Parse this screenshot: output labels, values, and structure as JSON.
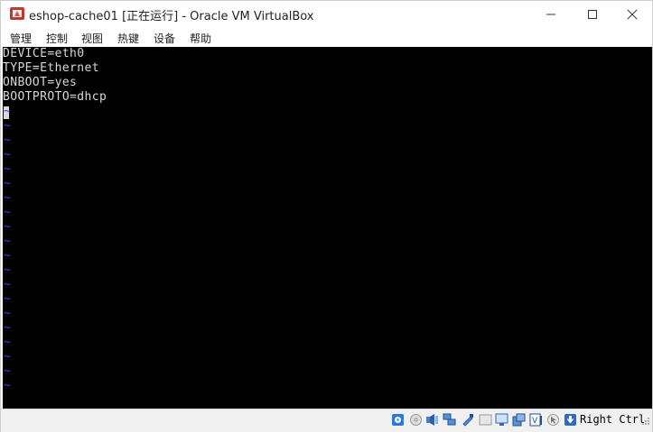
{
  "window": {
    "title": "eshop-cache01 [正在运行] - Oracle VM VirtualBox",
    "app_icon": "virtualbox-icon"
  },
  "menu": {
    "items": [
      "管理",
      "控制",
      "视图",
      "热键",
      "设备",
      "帮助"
    ]
  },
  "console": {
    "lines": [
      "DEVICE=eth0",
      "TYPE=Ethernet",
      "ONBOOT=yes",
      "BOOTPROTO=dhcp"
    ],
    "empty_marker": "~",
    "empty_line_count": 20,
    "colors": {
      "background": "#000000",
      "text": "#d8d8d8",
      "tilde": "#2f4fd8"
    }
  },
  "statusbar": {
    "icons": [
      "hard-disk-icon",
      "optical-drive-icon",
      "audio-icon",
      "network-icon",
      "usb-icon",
      "shared-folders-icon",
      "display-icon",
      "video-capture-icon",
      "graphics-icon",
      "mouse-integration-icon",
      "keyboard-icon"
    ],
    "host_key": "Right Ctrl"
  }
}
